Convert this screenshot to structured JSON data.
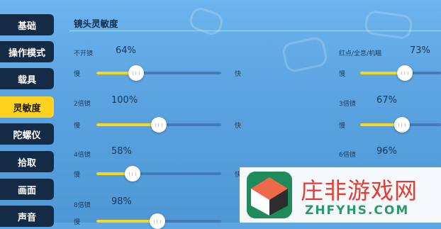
{
  "sidebar": {
    "items": [
      {
        "label": "基础"
      },
      {
        "label": "操作模式"
      },
      {
        "label": "载具"
      },
      {
        "label": "灵敏度"
      },
      {
        "label": "陀螺仪"
      },
      {
        "label": "拾取"
      },
      {
        "label": "画面"
      },
      {
        "label": "声音"
      }
    ],
    "active": "灵敏度"
  },
  "section": {
    "title": "镜头灵敏度"
  },
  "slider_ends": {
    "slow": "慢",
    "fast": "快"
  },
  "sliders": [
    {
      "label": "不开镜",
      "percent": "64%",
      "value": 64
    },
    {
      "label": "红点/全息/机瞄",
      "percent": "73%",
      "value": 73
    },
    {
      "label": "2倍镜",
      "percent": "100%",
      "value": 100
    },
    {
      "label": "3倍镜",
      "percent": "67%",
      "value": 67
    },
    {
      "label": "4倍镜",
      "percent": "58%",
      "value": 58
    },
    {
      "label": "6倍镜",
      "percent": "96%",
      "value": 96
    },
    {
      "label": "8倍镜",
      "percent": "98%",
      "value": 98
    }
  ],
  "watermark": {
    "name": "庄非游戏网",
    "domain": "ZHFYHS.COM"
  },
  "colors": {
    "accent": "#ffd21f",
    "sidebar": "#152a44",
    "track": "#3f7eb9",
    "brand_red": "#e63b2e",
    "brand_green": "#2b9a66"
  }
}
